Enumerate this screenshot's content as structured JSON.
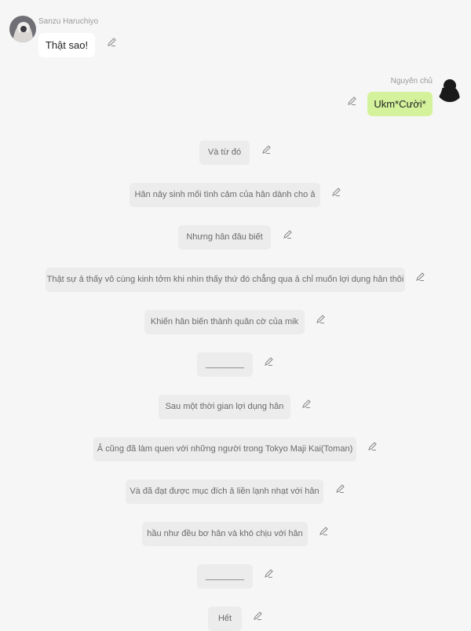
{
  "messages": [
    {
      "type": "left",
      "sender": "Sanzu Haruchiyo",
      "text": "Thật sao!"
    },
    {
      "type": "right",
      "sender": "Nguyên chủ",
      "text": "Ukm*Cười*"
    }
  ],
  "narration": [
    "Và từ đó",
    "Hân nảy sinh mối tình cảm của hân dành cho ả",
    "Nhưng hân đâu biết",
    "Thật sự ả thấy vô cùng kinh tởm khi nhìn thấy thứ đó chẳng qua ả chỉ muốn lợi dụng hân thôi",
    "Khiến hân biến thành quân cờ của mik",
    "________",
    "Sau một thời gian lợi dụng hân",
    "Ả cũng đã làm quen với những người trong Tokyo Maji Kai(Toman)",
    "Và đã đạt được mục đích ả liền lạnh nhạt với hân",
    "hầu như đều bơ hân và khó chịu với hân",
    "________",
    "Hết"
  ],
  "icons": {
    "edit": "pencil-icon"
  },
  "colors": {
    "background": "#f6f6f6",
    "green_bubble": "#d4f29b",
    "narration_bg": "#ececec"
  }
}
